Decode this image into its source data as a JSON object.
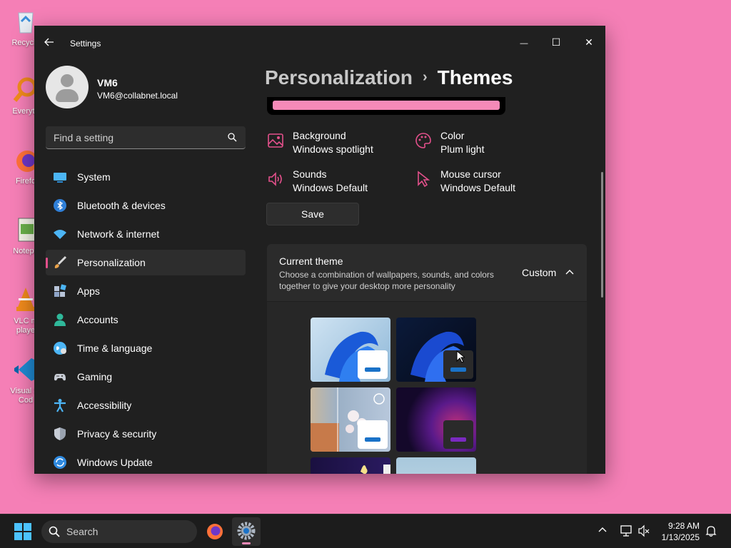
{
  "desktop": {
    "icons": [
      {
        "label": "Recycle",
        "icon": "recycle-bin-icon"
      },
      {
        "label": "Everyth",
        "icon": "everything-icon"
      },
      {
        "label": "Firefo",
        "icon": "firefox-icon"
      },
      {
        "label": "Notepa",
        "icon": "notepad-icon"
      },
      {
        "label": "VLC m\nplaye",
        "icon": "vlc-icon"
      },
      {
        "label": "Visual St\nCod",
        "icon": "vscode-icon"
      }
    ]
  },
  "window": {
    "title": "Settings",
    "controls": {
      "minimize": "—",
      "maximize": "☐",
      "close": "✕"
    }
  },
  "profile": {
    "name": "VM6",
    "email": "VM6@collabnet.local"
  },
  "search": {
    "placeholder": "Find a setting"
  },
  "nav": {
    "items": [
      {
        "label": "System",
        "icon": "system-icon"
      },
      {
        "label": "Bluetooth & devices",
        "icon": "bluetooth-icon"
      },
      {
        "label": "Network & internet",
        "icon": "wifi-icon"
      },
      {
        "label": "Personalization",
        "icon": "brush-icon",
        "active": true
      },
      {
        "label": "Apps",
        "icon": "apps-icon"
      },
      {
        "label": "Accounts",
        "icon": "accounts-icon"
      },
      {
        "label": "Time & language",
        "icon": "globe-icon"
      },
      {
        "label": "Gaming",
        "icon": "gamepad-icon"
      },
      {
        "label": "Accessibility",
        "icon": "accessibility-icon"
      },
      {
        "label": "Privacy & security",
        "icon": "shield-icon"
      },
      {
        "label": "Windows Update",
        "icon": "update-icon"
      }
    ]
  },
  "breadcrumb": {
    "parent": "Personalization",
    "separator": "›",
    "current": "Themes"
  },
  "theme_properties": {
    "background": {
      "label": "Background",
      "value": "Windows spotlight"
    },
    "color": {
      "label": "Color",
      "value": "Plum light"
    },
    "sounds": {
      "label": "Sounds",
      "value": "Windows Default"
    },
    "cursor": {
      "label": "Mouse cursor",
      "value": "Windows Default"
    }
  },
  "save_label": "Save",
  "current_theme": {
    "title": "Current theme",
    "description": "Choose a combination of wallpapers, sounds, and colors together to give your desktop more personality",
    "value": "Custom"
  },
  "themes": [
    {
      "name": "windows-light",
      "style": "light"
    },
    {
      "name": "windows-dark",
      "style": "dark"
    },
    {
      "name": "windows-spotlight",
      "style": "spotlight"
    },
    {
      "name": "glow",
      "style": "glow"
    },
    {
      "name": "captured-motion",
      "style": "partial"
    },
    {
      "name": "flow",
      "style": "partial"
    }
  ],
  "taskbar": {
    "search_label": "Search",
    "time": "9:28 AM",
    "date": "1/13/2025"
  },
  "colors": {
    "accent": "#e3508b",
    "desktop": "#f57fb6",
    "window_bg": "#202020",
    "taskbar_bg": "#1c1c1c"
  }
}
